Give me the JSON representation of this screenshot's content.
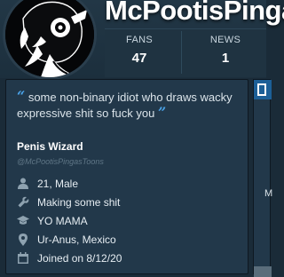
{
  "profile": {
    "username": "McPootisPinga",
    "display_name": "Penis Wizard",
    "handle": "@McPootisPingasToons",
    "bio": "some non-binary idiot who draws wacky expressive shit so fuck you"
  },
  "stats": {
    "fans_label": "FANS",
    "fans_value": "47",
    "news_label": "NEWS",
    "news_value": "1"
  },
  "info": [
    {
      "icon": "person-icon",
      "text": "21, Male"
    },
    {
      "icon": "wrench-icon",
      "text": "Making some shit"
    },
    {
      "icon": "graduation-cap-icon",
      "text": "YO MAMA"
    },
    {
      "icon": "location-pin-icon",
      "text": "Ur-Anus, Mexico"
    },
    {
      "icon": "calendar-icon",
      "text": "Joined on 8/12/20"
    }
  ],
  "side_panel": {
    "partial_text": "M"
  },
  "colors": {
    "accent": "#4aa3e8",
    "background": "#1a2b38",
    "card": "#22384a"
  }
}
